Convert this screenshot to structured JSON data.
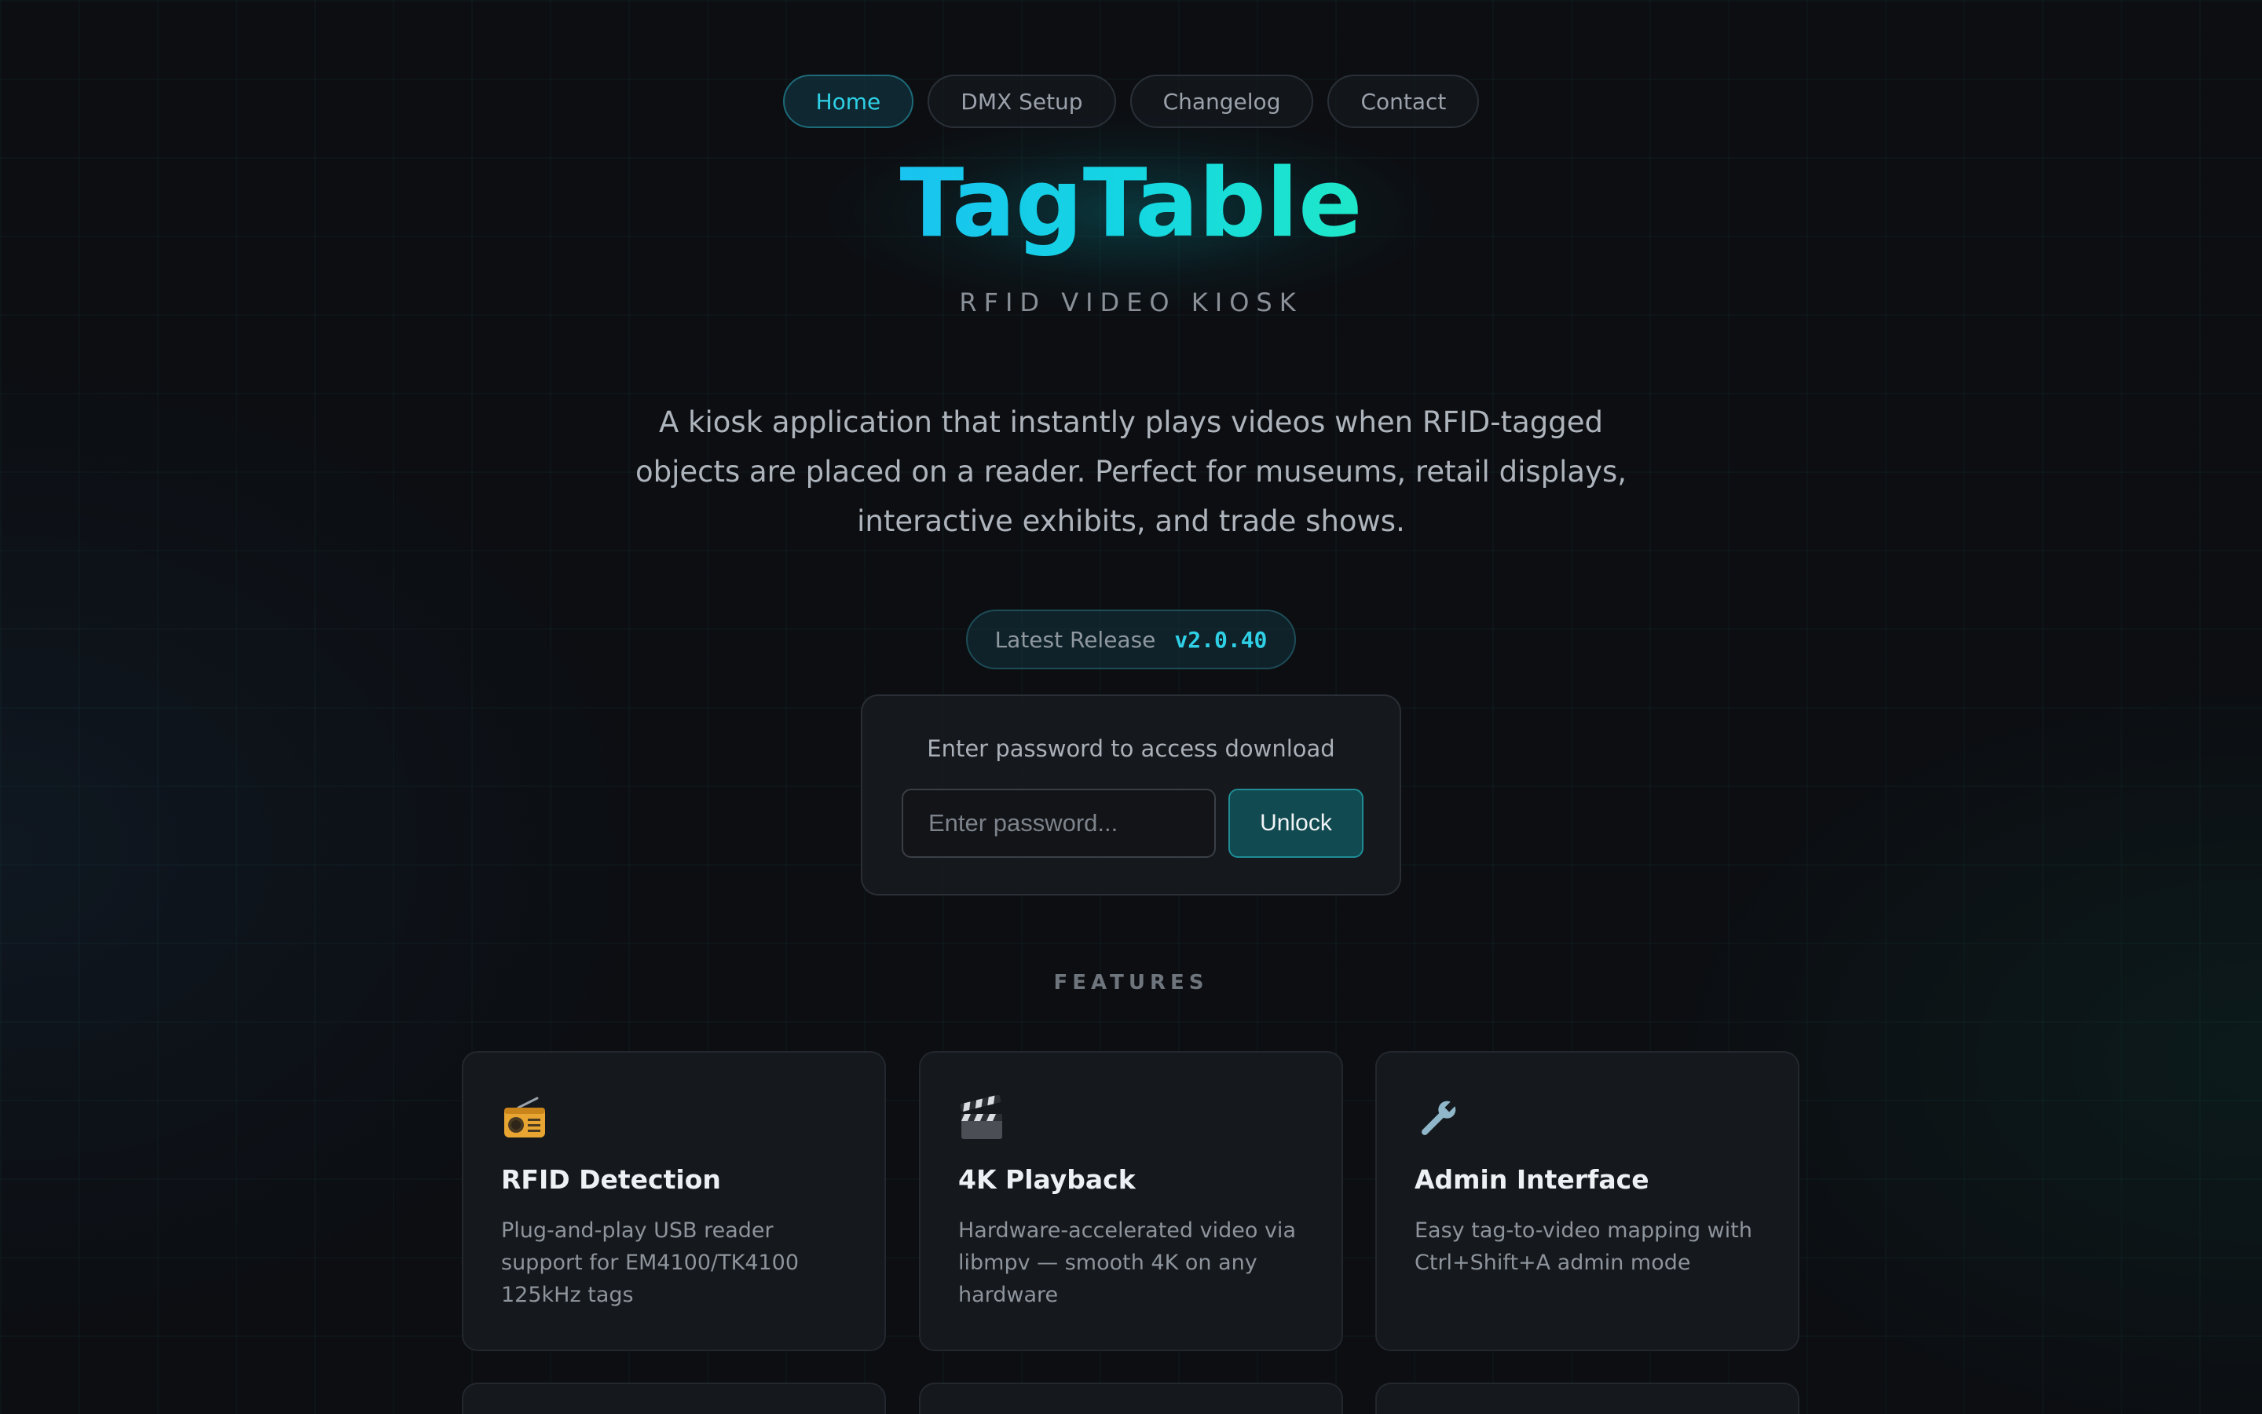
{
  "nav": {
    "items": [
      {
        "label": "Home",
        "active": true
      },
      {
        "label": "DMX Setup",
        "active": false
      },
      {
        "label": "Changelog",
        "active": false
      },
      {
        "label": "Contact",
        "active": false
      }
    ]
  },
  "hero": {
    "title": "TagTable",
    "subtitle": "RFID VIDEO KIOSK",
    "description": "A kiosk application that instantly plays videos when RFID-tagged objects are placed on a reader. Perfect for museums, retail displays, interactive exhibits, and trade shows."
  },
  "release": {
    "label": "Latest Release",
    "version": "v2.0.40"
  },
  "password": {
    "prompt": "Enter password to access download",
    "placeholder": "Enter password...",
    "value": "",
    "button_label": "Unlock"
  },
  "features": {
    "heading": "FEATURES",
    "cards": [
      {
        "icon": "radio-icon",
        "title": "RFID Detection",
        "description": "Plug-and-play USB reader support for EM4100/TK4100 125kHz tags"
      },
      {
        "icon": "clapperboard-icon",
        "title": "4K Playback",
        "description": "Hardware-accelerated video via libmpv — smooth 4K on any hardware"
      },
      {
        "icon": "wrench-icon",
        "title": "Admin Interface",
        "description": "Easy tag-to-video mapping with Ctrl+Shift+A admin mode"
      }
    ]
  },
  "colors": {
    "accent": "#2fd0e6",
    "accent_green": "#1fe8c8",
    "background": "#0c0e12",
    "card": "#16191e"
  }
}
